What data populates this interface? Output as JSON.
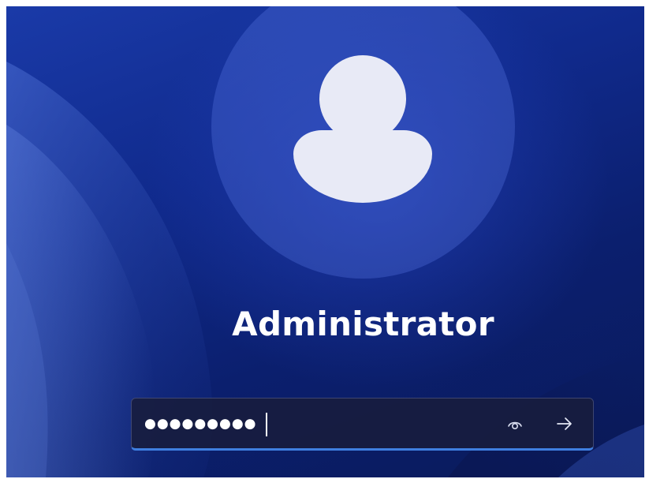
{
  "user": {
    "name": "Administrator"
  },
  "password_field": {
    "value": "●●●●●●●●●",
    "reveal_icon": "eye-icon",
    "submit_icon": "arrow-right-icon"
  },
  "colors": {
    "background_primary": "#102a8c",
    "avatar_fill": "#e8eaf6",
    "field_accent": "#3f7fe0"
  }
}
